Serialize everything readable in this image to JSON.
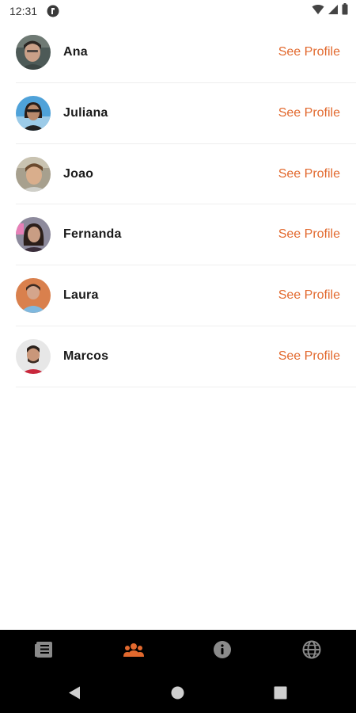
{
  "status_bar": {
    "time": "12:31"
  },
  "contacts": [
    {
      "name": "Ana",
      "action": "See Profile",
      "avatar": "avatar-ana"
    },
    {
      "name": "Juliana",
      "action": "See Profile",
      "avatar": "avatar-juliana"
    },
    {
      "name": "Joao",
      "action": "See Profile",
      "avatar": "avatar-joao"
    },
    {
      "name": "Fernanda",
      "action": "See Profile",
      "avatar": "avatar-fernanda"
    },
    {
      "name": "Laura",
      "action": "See Profile",
      "avatar": "avatar-laura"
    },
    {
      "name": "Marcos",
      "action": "See Profile",
      "avatar": "avatar-marcos"
    }
  ],
  "tabs": [
    {
      "icon": "news-list-icon",
      "active": false
    },
    {
      "icon": "people-icon",
      "active": true
    },
    {
      "icon": "info-icon",
      "active": false
    },
    {
      "icon": "globe-icon",
      "active": false
    }
  ],
  "colors": {
    "accent": "#E2692E",
    "tab_inactive": "#8a8a8a",
    "tab_bar": "#000000",
    "divider": "#eeeeee"
  }
}
